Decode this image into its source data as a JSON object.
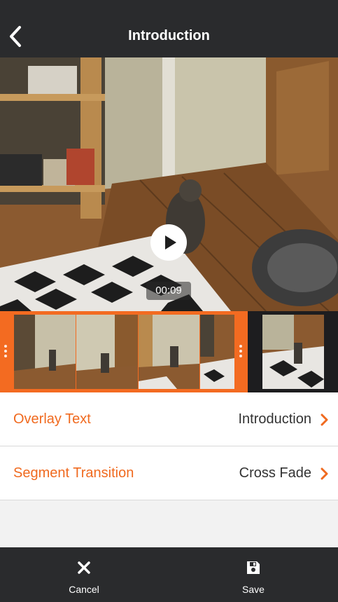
{
  "header": {
    "title": "Introduction",
    "back_icon": "chevron-left-icon"
  },
  "video": {
    "timecode": "00:09",
    "play_icon": "play-icon"
  },
  "colors": {
    "accent": "#f36b21",
    "bar": "#2a2b2d",
    "background": "#f2f2f2"
  },
  "settings": {
    "overlay_text": {
      "label": "Overlay Text",
      "value": "Introduction"
    },
    "segment_transition": {
      "label": "Segment Transition",
      "value": "Cross Fade"
    }
  },
  "toolbar": {
    "cancel_label": "Cancel",
    "cancel_icon": "close-icon",
    "save_label": "Save",
    "save_icon": "floppy-disk-icon"
  }
}
